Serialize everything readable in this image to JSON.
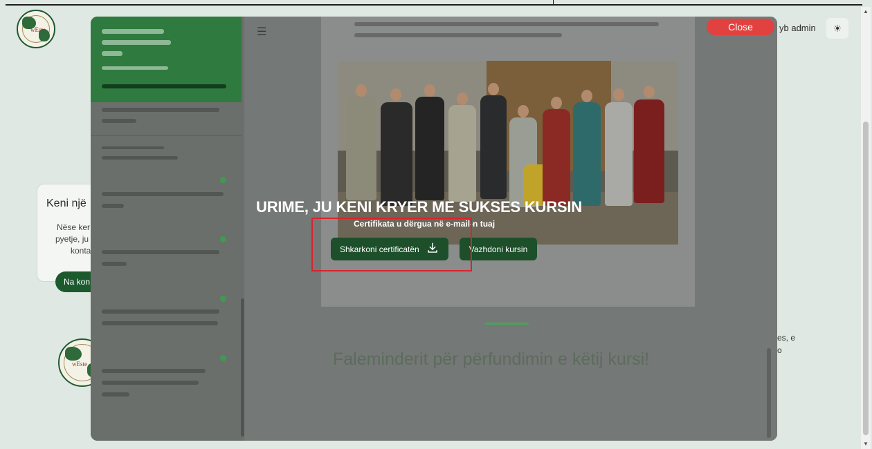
{
  "header": {
    "user_label": "yb admin",
    "theme_icon": "sun-icon"
  },
  "background": {
    "card_title": "Keni një",
    "card_lines": [
      "Nëse ker",
      "pyetje, ju",
      "konta"
    ],
    "card_button": "Na kon",
    "right_fragments": [
      "es, e",
      "o"
    ]
  },
  "modal": {
    "close_label": "Close",
    "congrats_title": "URIME, JU KENI KRYER ME SUKSES KURSIN",
    "sent_message": "Certifikata u dërgua në e-mail-n tuaj",
    "download_label": "Shkarkoni certificatën",
    "download_icon": "download-icon",
    "continue_label": "Vazhdoni kursin",
    "thanks_text": "Faleminderit për përfundimin e këtij kursi!"
  },
  "colors": {
    "button_green": "#1c4f2a",
    "close_red": "#e2423f",
    "highlight_red": "#d9232d"
  }
}
